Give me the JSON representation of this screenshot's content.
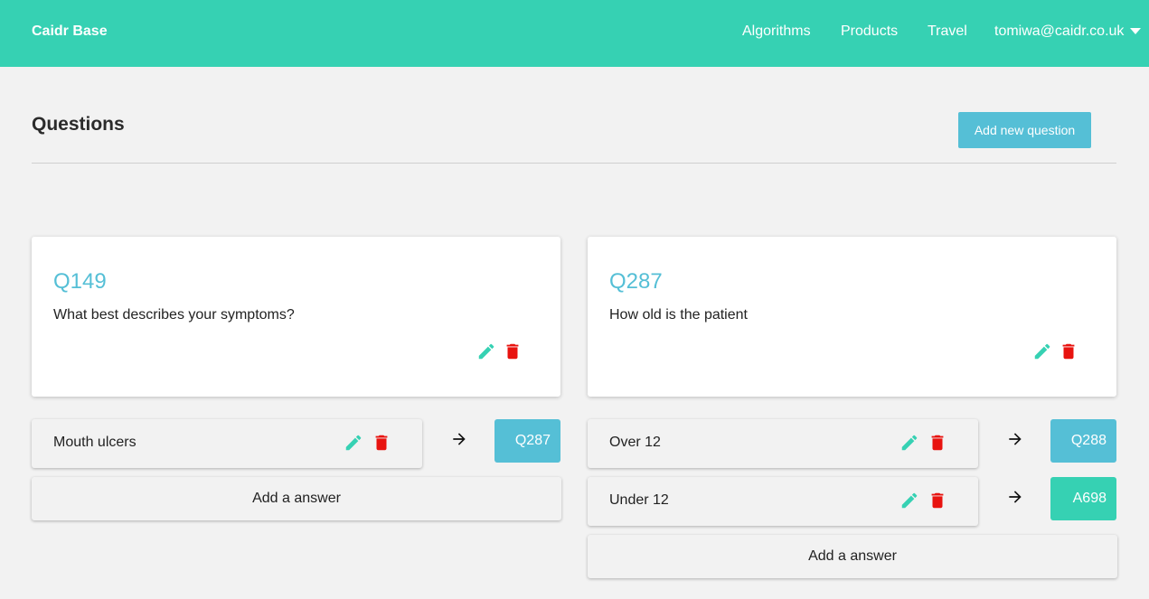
{
  "navbar": {
    "brand": "Caidr Base",
    "links": [
      "Algorithms",
      "Products",
      "Travel"
    ],
    "user_email": "tomiwa@caidr.co.uk"
  },
  "page": {
    "title": "Questions",
    "add_question_label": "Add new question",
    "add_answer_label": "Add a answer"
  },
  "questions": [
    {
      "id": "Q149",
      "text": "What best describes your symptoms?",
      "answers": [
        {
          "text": "Mouth ulcers",
          "target": "Q287"
        }
      ]
    },
    {
      "id": "Q287",
      "text": "How old is the patient",
      "answers": [
        {
          "text": "Over 12",
          "target": "Q288"
        },
        {
          "text": "Under 12",
          "target": "A698"
        }
      ]
    }
  ],
  "colors": {
    "navbar": "#36d1b3",
    "question_id": "#55bfd6",
    "question_target": "#55bfd6",
    "answer_target": "#36d1b3",
    "edit_icon": "#36d1b3",
    "delete_icon": "#e8130f"
  },
  "icons": {
    "edit": "pencil-icon",
    "delete": "trash-icon",
    "link": "arrow-right-icon",
    "menu": "caret-down-icon"
  }
}
